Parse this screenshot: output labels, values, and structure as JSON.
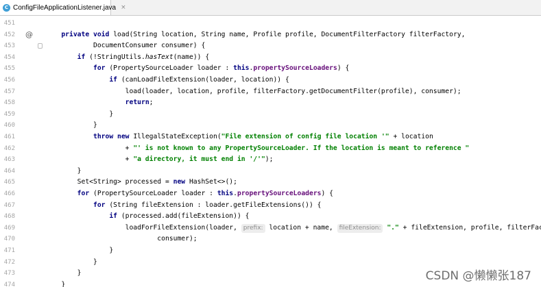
{
  "tab": {
    "icon": "java-class-icon",
    "filename": "ConfigFileApplicationListener.java",
    "close": "×"
  },
  "gutter_marker": "@",
  "lines": [
    {
      "n": "451",
      "t": []
    },
    {
      "n": "452",
      "t": [
        [
          "    ",
          ""
        ],
        [
          "private",
          "kw"
        ],
        [
          " ",
          ""
        ],
        [
          "void",
          "kw"
        ],
        [
          " load(String location, String name, Profile profile, DocumentFilterFactory filterFactory,",
          ""
        ]
      ]
    },
    {
      "n": "453",
      "t": [
        [
          "            DocumentConsumer consumer) {",
          ""
        ]
      ]
    },
    {
      "n": "454",
      "t": [
        [
          "        ",
          ""
        ],
        [
          "if",
          "kw"
        ],
        [
          " (!StringUtils.",
          ""
        ],
        [
          "hasText",
          "it"
        ],
        [
          "(name)) {",
          ""
        ]
      ]
    },
    {
      "n": "455",
      "t": [
        [
          "            ",
          ""
        ],
        [
          "for",
          "kw"
        ],
        [
          " (PropertySourceLoader loader : ",
          ""
        ],
        [
          "this",
          "kw"
        ],
        [
          ".",
          ""
        ],
        [
          "propertySourceLoaders",
          "fld"
        ],
        [
          ") {",
          ""
        ]
      ]
    },
    {
      "n": "456",
      "t": [
        [
          "                ",
          ""
        ],
        [
          "if",
          "kw"
        ],
        [
          " (canLoadFileExtension(loader, location)) {",
          ""
        ]
      ]
    },
    {
      "n": "457",
      "t": [
        [
          "                    load(loader, location, profile, filterFactory.getDocumentFilter(profile), consumer);",
          ""
        ]
      ]
    },
    {
      "n": "458",
      "t": [
        [
          "                    ",
          ""
        ],
        [
          "return",
          "kw"
        ],
        [
          ";",
          ""
        ]
      ]
    },
    {
      "n": "459",
      "t": [
        [
          "                }",
          ""
        ]
      ]
    },
    {
      "n": "460",
      "t": [
        [
          "            }",
          ""
        ]
      ]
    },
    {
      "n": "461",
      "t": [
        [
          "            ",
          ""
        ],
        [
          "throw",
          "kw"
        ],
        [
          " ",
          ""
        ],
        [
          "new",
          "kw"
        ],
        [
          " IllegalStateException(",
          ""
        ],
        [
          "\"File extension of config file location '\"",
          "str"
        ],
        [
          " + location",
          ""
        ]
      ]
    },
    {
      "n": "462",
      "t": [
        [
          "                    + ",
          ""
        ],
        [
          "\"' is not known to any PropertySourceLoader. If the location is meant to reference \"",
          "str"
        ]
      ]
    },
    {
      "n": "463",
      "t": [
        [
          "                    + ",
          ""
        ],
        [
          "\"a directory, it must end in '/'\"",
          "str"
        ],
        [
          ");",
          ""
        ]
      ]
    },
    {
      "n": "464",
      "t": [
        [
          "        }",
          ""
        ]
      ]
    },
    {
      "n": "465",
      "t": [
        [
          "        Set<String> processed = ",
          ""
        ],
        [
          "new",
          "kw"
        ],
        [
          " HashSet<>();",
          ""
        ]
      ]
    },
    {
      "n": "466",
      "t": [
        [
          "        ",
          ""
        ],
        [
          "for",
          "kw"
        ],
        [
          " (PropertySourceLoader loader : ",
          ""
        ],
        [
          "this",
          "kw"
        ],
        [
          ".",
          ""
        ],
        [
          "propertySourceLoaders",
          "fld"
        ],
        [
          ") {",
          ""
        ]
      ]
    },
    {
      "n": "467",
      "t": [
        [
          "            ",
          ""
        ],
        [
          "for",
          "kw"
        ],
        [
          " (String fileExtension : loader.getFileExtensions()) {",
          ""
        ]
      ]
    },
    {
      "n": "468",
      "t": [
        [
          "                ",
          ""
        ],
        [
          "if",
          "kw"
        ],
        [
          " (processed.add(fileExtension)) {",
          ""
        ]
      ]
    },
    {
      "n": "469",
      "t": [
        [
          "                    loadForFileExtension(loader, ",
          ""
        ],
        [
          "prefix:",
          "hint"
        ],
        [
          " location + name, ",
          ""
        ],
        [
          "fileExtension:",
          "hint"
        ],
        [
          " ",
          ""
        ],
        [
          "\".\"",
          "str"
        ],
        [
          " + fileExtension, profile, filterFactory,",
          ""
        ]
      ]
    },
    {
      "n": "470",
      "t": [
        [
          "                            consumer);",
          ""
        ]
      ]
    },
    {
      "n": "471",
      "t": [
        [
          "                }",
          ""
        ]
      ]
    },
    {
      "n": "472",
      "t": [
        [
          "            }",
          ""
        ]
      ]
    },
    {
      "n": "473",
      "t": [
        [
          "        }",
          ""
        ]
      ]
    },
    {
      "n": "474",
      "t": [
        [
          "    }",
          ""
        ]
      ]
    }
  ],
  "watermark": "CSDN @懒懒张187"
}
